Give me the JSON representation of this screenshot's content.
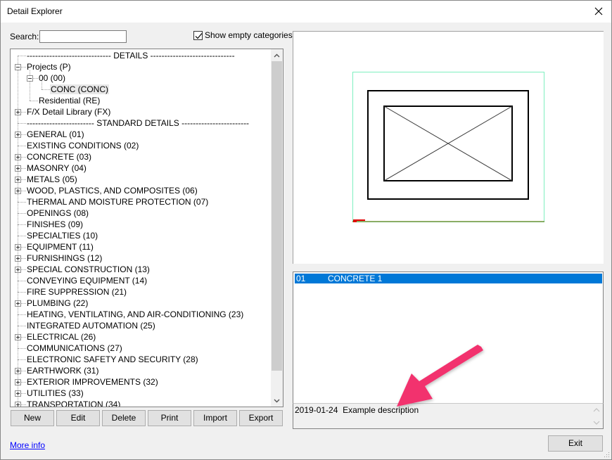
{
  "window": {
    "title": "Detail Explorer",
    "close_icon": "close-icon"
  },
  "search": {
    "label": "Search:",
    "value": "",
    "placeholder": ""
  },
  "show_empty": {
    "label": "Show empty categories",
    "checked": true
  },
  "tree": {
    "rows": [
      {
        "label": "------------------------------ DETAILS ------------------------------",
        "level": 0,
        "expander": "none",
        "selected": false
      },
      {
        "label": "Projects (P)",
        "level": 0,
        "expander": "minus",
        "selected": false
      },
      {
        "label": "00 (00)",
        "level": 1,
        "expander": "minus",
        "selected": false
      },
      {
        "label": "CONC (CONC)",
        "level": 2,
        "expander": "none",
        "selected": true
      },
      {
        "label": "Residential (RE)",
        "level": 1,
        "expander": "none",
        "selected": false
      },
      {
        "label": "F/X Detail Library (FX)",
        "level": 0,
        "expander": "plus",
        "selected": false
      },
      {
        "label": "------------------------ STANDARD DETAILS ------------------------",
        "level": 0,
        "expander": "none",
        "selected": false
      },
      {
        "label": "GENERAL (01)",
        "level": 0,
        "expander": "plus",
        "selected": false
      },
      {
        "label": "EXISTING CONDITIONS (02)",
        "level": 0,
        "expander": "none",
        "selected": false
      },
      {
        "label": "CONCRETE (03)",
        "level": 0,
        "expander": "plus",
        "selected": false
      },
      {
        "label": "MASONRY (04)",
        "level": 0,
        "expander": "plus",
        "selected": false
      },
      {
        "label": "METALS (05)",
        "level": 0,
        "expander": "plus",
        "selected": false
      },
      {
        "label": "WOOD, PLASTICS, AND COMPOSITES (06)",
        "level": 0,
        "expander": "plus",
        "selected": false
      },
      {
        "label": "THERMAL AND MOISTURE PROTECTION (07)",
        "level": 0,
        "expander": "none",
        "selected": false
      },
      {
        "label": "OPENINGS (08)",
        "level": 0,
        "expander": "none",
        "selected": false
      },
      {
        "label": "FINISHES (09)",
        "level": 0,
        "expander": "none",
        "selected": false
      },
      {
        "label": "SPECIALTIES (10)",
        "level": 0,
        "expander": "none",
        "selected": false
      },
      {
        "label": "EQUIPMENT (11)",
        "level": 0,
        "expander": "plus",
        "selected": false
      },
      {
        "label": "FURNISHINGS (12)",
        "level": 0,
        "expander": "plus",
        "selected": false
      },
      {
        "label": "SPECIAL CONSTRUCTION (13)",
        "level": 0,
        "expander": "plus",
        "selected": false
      },
      {
        "label": "CONVEYING EQUIPMENT (14)",
        "level": 0,
        "expander": "none",
        "selected": false
      },
      {
        "label": "FIRE SUPPRESSION (21)",
        "level": 0,
        "expander": "none",
        "selected": false
      },
      {
        "label": "PLUMBING (22)",
        "level": 0,
        "expander": "plus",
        "selected": false
      },
      {
        "label": "HEATING, VENTILATING, AND AIR-CONDITIONING (23)",
        "level": 0,
        "expander": "none",
        "selected": false
      },
      {
        "label": "INTEGRATED AUTOMATION (25)",
        "level": 0,
        "expander": "none",
        "selected": false
      },
      {
        "label": "ELECTRICAL (26)",
        "level": 0,
        "expander": "plus",
        "selected": false
      },
      {
        "label": "COMMUNICATIONS (27)",
        "level": 0,
        "expander": "none",
        "selected": false
      },
      {
        "label": "ELECTRONIC SAFETY AND SECURITY (28)",
        "level": 0,
        "expander": "none",
        "selected": false
      },
      {
        "label": "EARTHWORK (31)",
        "level": 0,
        "expander": "plus",
        "selected": false
      },
      {
        "label": "EXTERIOR IMPROVEMENTS (32)",
        "level": 0,
        "expander": "plus",
        "selected": false
      },
      {
        "label": "UTILITIES (33)",
        "level": 0,
        "expander": "plus",
        "selected": false
      },
      {
        "label": "TRANSPORTATION (34)",
        "level": 0,
        "expander": "plus",
        "selected": false
      }
    ]
  },
  "buttons": {
    "new": "New",
    "edit": "Edit",
    "delete": "Delete",
    "print": "Print",
    "import": "Import",
    "export": "Export",
    "exit": "Exit"
  },
  "more_info": "More info",
  "details_list": {
    "rows": [
      {
        "number": "01",
        "name": "CONCRETE 1",
        "selected": true
      }
    ]
  },
  "description": {
    "date": "2019-01-24",
    "text": "Example description"
  },
  "colors": {
    "selection": "#0078d7",
    "annotation_arrow": "#f2336e",
    "link": "#0000ff"
  }
}
